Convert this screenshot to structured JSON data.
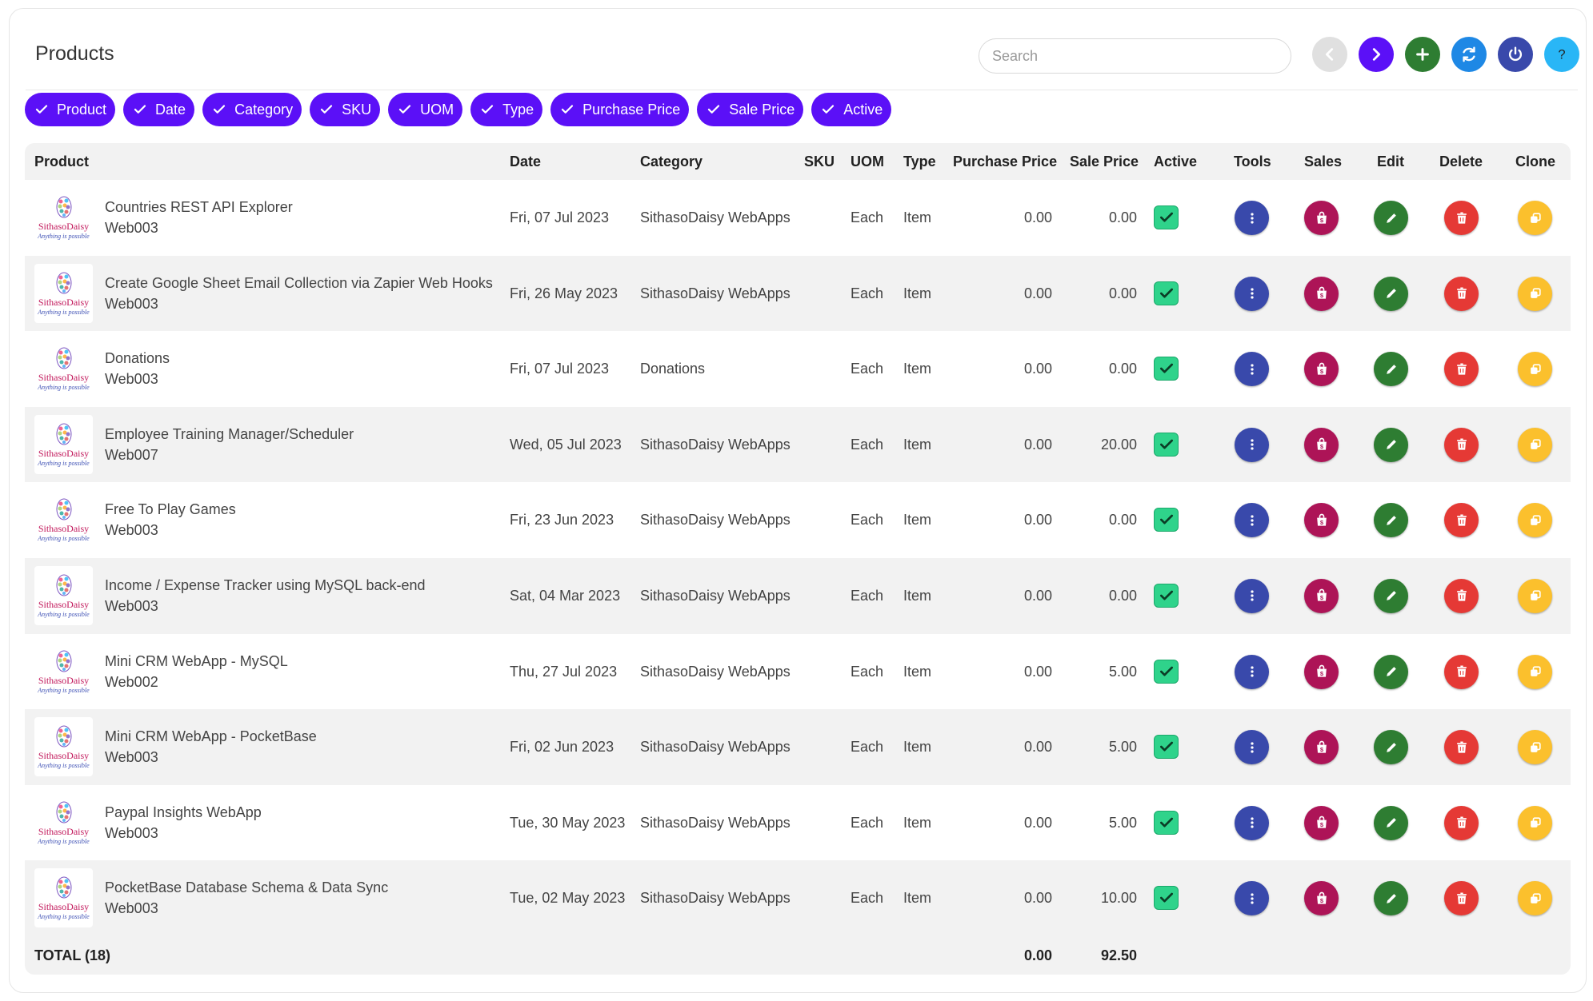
{
  "header": {
    "title": "Products",
    "search_placeholder": "Search",
    "buttons": [
      {
        "name": "back",
        "icon": "chevron-left-icon",
        "color": "#e0e0e0"
      },
      {
        "name": "forward",
        "icon": "chevron-right-icon",
        "color": "#5b10f7"
      },
      {
        "name": "add",
        "icon": "plus-icon",
        "color": "#2e7d32"
      },
      {
        "name": "refresh",
        "icon": "refresh-icon",
        "color": "#1e88e5"
      },
      {
        "name": "logout",
        "icon": "power-icon",
        "color": "#3949ab"
      },
      {
        "name": "help",
        "icon": "question-icon",
        "color": "#29b6f6"
      }
    ]
  },
  "filters": [
    "Product",
    "Date",
    "Category",
    "SKU",
    "UOM",
    "Type",
    "Purchase Price",
    "Sale Price",
    "Active"
  ],
  "columns": {
    "product": "Product",
    "date": "Date",
    "category": "Category",
    "sku": "SKU",
    "uom": "UOM",
    "type": "Type",
    "purchase_price": "Purchase Price",
    "sale_price": "Sale Price",
    "active": "Active",
    "tools": "Tools",
    "sales": "Sales",
    "edit": "Edit",
    "delete": "Delete",
    "clone": "Clone"
  },
  "logo": {
    "brand": "SithasoDaisy",
    "tagline": "Anything is possible"
  },
  "colors": {
    "accent": "#5b10f7",
    "tools": "#3949ab",
    "sales": "#ad1457",
    "edit": "#2e7d32",
    "delete": "#e53935",
    "clone": "#fbc02d",
    "active": "#2fd38b"
  },
  "rows": [
    {
      "name": "Countries REST API Explorer",
      "sku": "Web003",
      "date": "Fri, 07 Jul 2023",
      "category": "SithasoDaisy WebApps",
      "uom": "Each",
      "type": "Item",
      "purchase": "0.00",
      "sale": "0.00",
      "active": true
    },
    {
      "name": "Create Google Sheet Email Collection via Zapier Web Hooks",
      "sku": "Web003",
      "date": "Fri, 26 May 2023",
      "category": "SithasoDaisy WebApps",
      "uom": "Each",
      "type": "Item",
      "purchase": "0.00",
      "sale": "0.00",
      "active": true
    },
    {
      "name": "Donations",
      "sku": "Web003",
      "date": "Fri, 07 Jul 2023",
      "category": "Donations",
      "uom": "Each",
      "type": "Item",
      "purchase": "0.00",
      "sale": "0.00",
      "active": true
    },
    {
      "name": "Employee Training Manager/Scheduler",
      "sku": "Web007",
      "date": "Wed, 05 Jul 2023",
      "category": "SithasoDaisy WebApps",
      "uom": "Each",
      "type": "Item",
      "purchase": "0.00",
      "sale": "20.00",
      "active": true
    },
    {
      "name": "Free To Play Games",
      "sku": "Web003",
      "date": "Fri, 23 Jun 2023",
      "category": "SithasoDaisy WebApps",
      "uom": "Each",
      "type": "Item",
      "purchase": "0.00",
      "sale": "0.00",
      "active": true
    },
    {
      "name": "Income / Expense Tracker using MySQL back-end",
      "sku": "Web003",
      "date": "Sat, 04 Mar 2023",
      "category": "SithasoDaisy WebApps",
      "uom": "Each",
      "type": "Item",
      "purchase": "0.00",
      "sale": "0.00",
      "active": true
    },
    {
      "name": "Mini CRM WebApp - MySQL",
      "sku": "Web002",
      "date": "Thu, 27 Jul 2023",
      "category": "SithasoDaisy WebApps",
      "uom": "Each",
      "type": "Item",
      "purchase": "0.00",
      "sale": "5.00",
      "active": true
    },
    {
      "name": "Mini CRM WebApp - PocketBase",
      "sku": "Web003",
      "date": "Fri, 02 Jun 2023",
      "category": "SithasoDaisy WebApps",
      "uom": "Each",
      "type": "Item",
      "purchase": "0.00",
      "sale": "5.00",
      "active": true
    },
    {
      "name": "Paypal Insights WebApp",
      "sku": "Web003",
      "date": "Tue, 30 May 2023",
      "category": "SithasoDaisy WebApps",
      "uom": "Each",
      "type": "Item",
      "purchase": "0.00",
      "sale": "5.00",
      "active": true
    },
    {
      "name": "PocketBase Database Schema & Data Sync",
      "sku": "Web003",
      "date": "Tue, 02 May 2023",
      "category": "SithasoDaisy WebApps",
      "uom": "Each",
      "type": "Item",
      "purchase": "0.00",
      "sale": "10.00",
      "active": true
    }
  ],
  "footer": {
    "label": "TOTAL (18)",
    "purchase_total": "0.00",
    "sale_total": "92.50"
  }
}
